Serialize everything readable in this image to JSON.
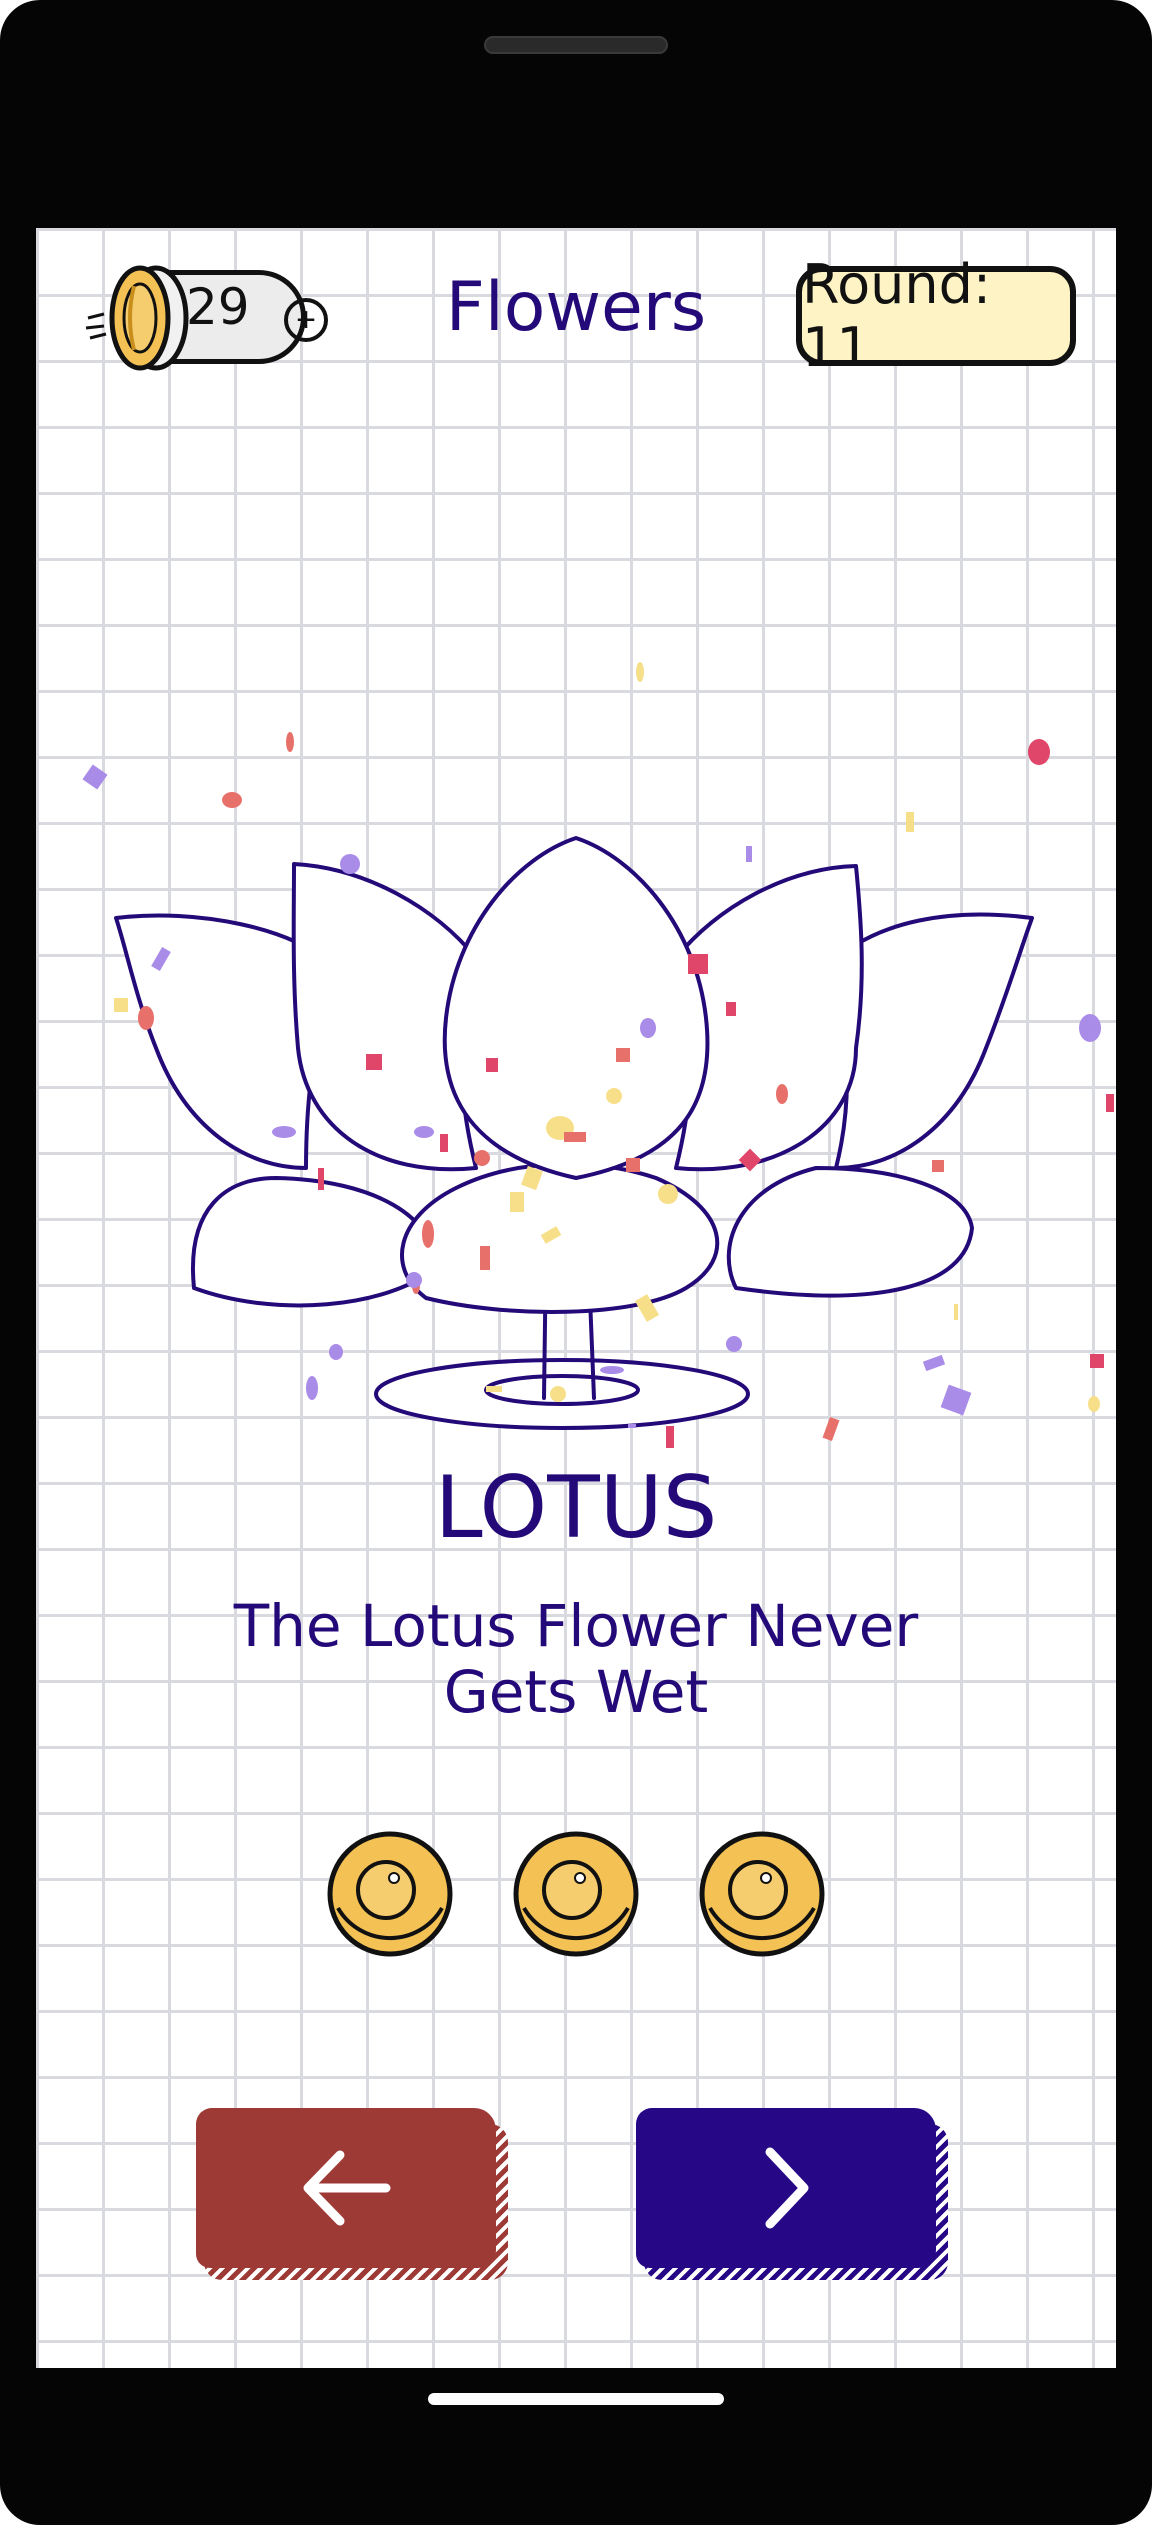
{
  "header": {
    "coin_count": "29",
    "plus_label": "+",
    "category_title": "Flowers",
    "round_label": "Round: 11"
  },
  "card": {
    "word": "LOTUS",
    "fact": "The Lotus Flower Never Gets Wet",
    "reward_coins": 3
  },
  "icons": {
    "coin": "coin-icon",
    "plus": "plus-circle-icon",
    "back": "arrow-left-icon",
    "next": "chevron-right-icon"
  },
  "colors": {
    "ink": "#240a78",
    "back_button": "#9e3a36",
    "next_button": "#260785",
    "coin_gold": "#f4c155",
    "round_badge": "#fdf3c4"
  }
}
